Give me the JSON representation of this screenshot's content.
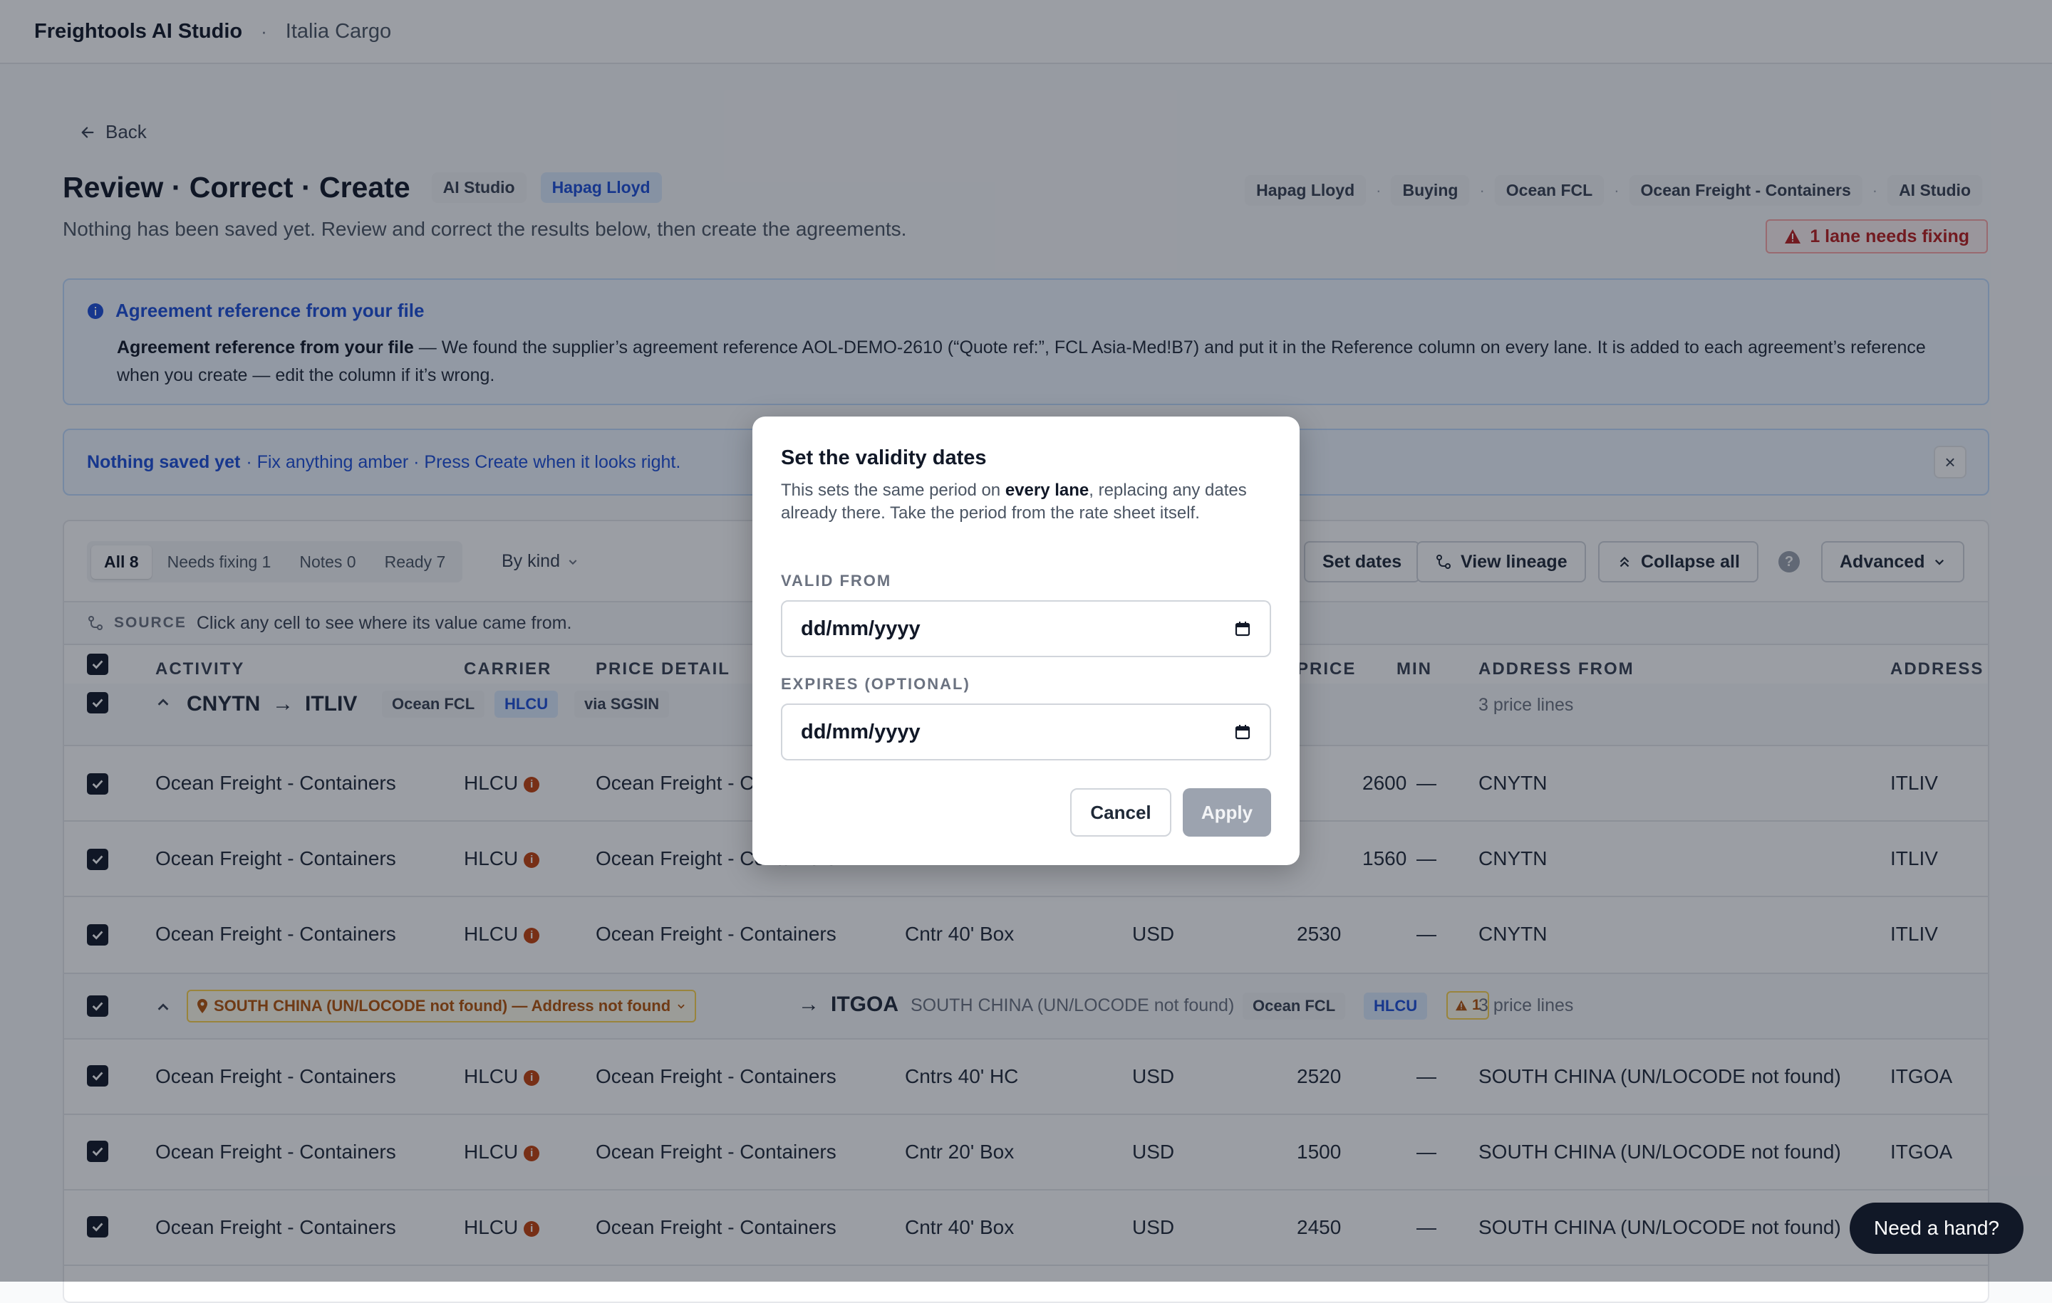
{
  "app": {
    "brand": "Freightools AI Studio",
    "org": "Italia Cargo"
  },
  "nav": {
    "back": "Back"
  },
  "page": {
    "title": "Review · Correct · Create",
    "badges": [
      "AI Studio",
      "Hapag Lloyd"
    ],
    "subtitle": "Nothing has been saved yet. Review and correct the results below, then create the agreements.",
    "breadcrumbs": [
      "Hapag Lloyd",
      "Buying",
      "Ocean FCL",
      "Ocean Freight - Containers",
      "AI Studio"
    ],
    "needs_fixing": "1 lane needs fixing"
  },
  "info": {
    "heading": "Agreement reference from your file",
    "body_bold": "Agreement reference from your file",
    "body_rest": " — We found the supplier’s agreement reference AOL-DEMO-2610 (“Quote ref:”, FCL Asia-Med!B7) and put it in the Reference column on every lane. It is added to each agreement’s reference when you create — edit the column if it’s wrong."
  },
  "notice": {
    "bold": "Nothing saved yet",
    "rest": "· Fix anything amber · Press Create when it looks right.",
    "close": "×"
  },
  "toolbar": {
    "filters": [
      "All 8",
      "Needs fixing 1",
      "Notes 0",
      "Ready 7"
    ],
    "group_by": "By kind",
    "set_dates": "Set dates",
    "view_lineage": "View lineage",
    "collapse_all": "Collapse all",
    "help": "?",
    "advanced": "Advanced"
  },
  "source": {
    "tag": "SOURCE",
    "text": "Click any cell to see where its value came from."
  },
  "columns": {
    "activity": "ACTIVITY",
    "carrier": "CARRIER",
    "price_detail": "PRICE DETAIL",
    "price": "PRICE",
    "min": "MIN",
    "address_from": "ADDRESS FROM",
    "address_to": "ADDRESS T"
  },
  "lanes": [
    {
      "from": "CNYTN",
      "arrow": "→",
      "to": "ITLIV",
      "chips": [
        "Ocean FCL",
        "HLCU",
        "via SGSIN"
      ],
      "price_lines": "3 price lines",
      "rows": [
        {
          "activity": "Ocean Freight - Containers",
          "carrier": "HLCU",
          "price_detail": "Ocean Freight - Containers",
          "equipment": "",
          "currency": "",
          "price": "2600",
          "min": "—",
          "from": "CNYTN",
          "to": "ITLIV"
        },
        {
          "activity": "Ocean Freight - Containers",
          "carrier": "HLCU",
          "price_detail": "Ocean Freight - Containers",
          "equipment": "",
          "currency": "",
          "price": "1560",
          "min": "—",
          "from": "CNYTN",
          "to": "ITLIV"
        },
        {
          "activity": "Ocean Freight - Containers",
          "carrier": "HLCU",
          "price_detail": "Ocean Freight - Containers",
          "equipment": "Cntr 40' Box",
          "currency": "USD",
          "price": "2530",
          "min": "—",
          "from": "CNYTN",
          "to": "ITLIV"
        }
      ]
    },
    {
      "from_warning": "SOUTH CHINA (UN/LOCODE not found) — Address not found",
      "arrow": "→",
      "to": "ITGOA",
      "to_note": "SOUTH CHINA (UN/LOCODE not found)",
      "chips": [
        "Ocean FCL",
        "HLCU"
      ],
      "warn_count": "1",
      "price_lines": "3 price lines",
      "rows": [
        {
          "activity": "Ocean Freight - Containers",
          "carrier": "HLCU",
          "price_detail": "Ocean Freight - Containers",
          "equipment": "Cntrs 40' HC",
          "currency": "USD",
          "price": "2520",
          "min": "—",
          "from": "SOUTH CHINA (UN/LOCODE not found)",
          "to": "ITGOA"
        },
        {
          "activity": "Ocean Freight - Containers",
          "carrier": "HLCU",
          "price_detail": "Ocean Freight - Containers",
          "equipment": "Cntr 20' Box",
          "currency": "USD",
          "price": "1500",
          "min": "—",
          "from": "SOUTH CHINA (UN/LOCODE not found)",
          "to": "ITGOA"
        },
        {
          "activity": "Ocean Freight - Containers",
          "carrier": "HLCU",
          "price_detail": "Ocean Freight - Containers",
          "equipment": "Cntr 40' Box",
          "currency": "USD",
          "price": "2450",
          "min": "—",
          "from": "SOUTH CHINA (UN/LOCODE not found)",
          "to": ""
        }
      ]
    }
  ],
  "modal": {
    "title": "Set the validity dates",
    "text_before": "This sets the same period on ",
    "text_bold": "every lane",
    "text_after": ", replacing any dates already there. Take the period from the rate sheet itself.",
    "valid_from_label": "VALID FROM",
    "valid_from_value": "dd/mm/yyyy",
    "expires_label": "EXPIRES (OPTIONAL)",
    "expires_value": "dd/mm/yyyy",
    "cancel": "Cancel",
    "apply": "Apply"
  },
  "help_bubble": "Need a hand?",
  "colors": {
    "accent": "#1d4ed8",
    "warning": "#b45309",
    "danger": "#b91c1c"
  }
}
